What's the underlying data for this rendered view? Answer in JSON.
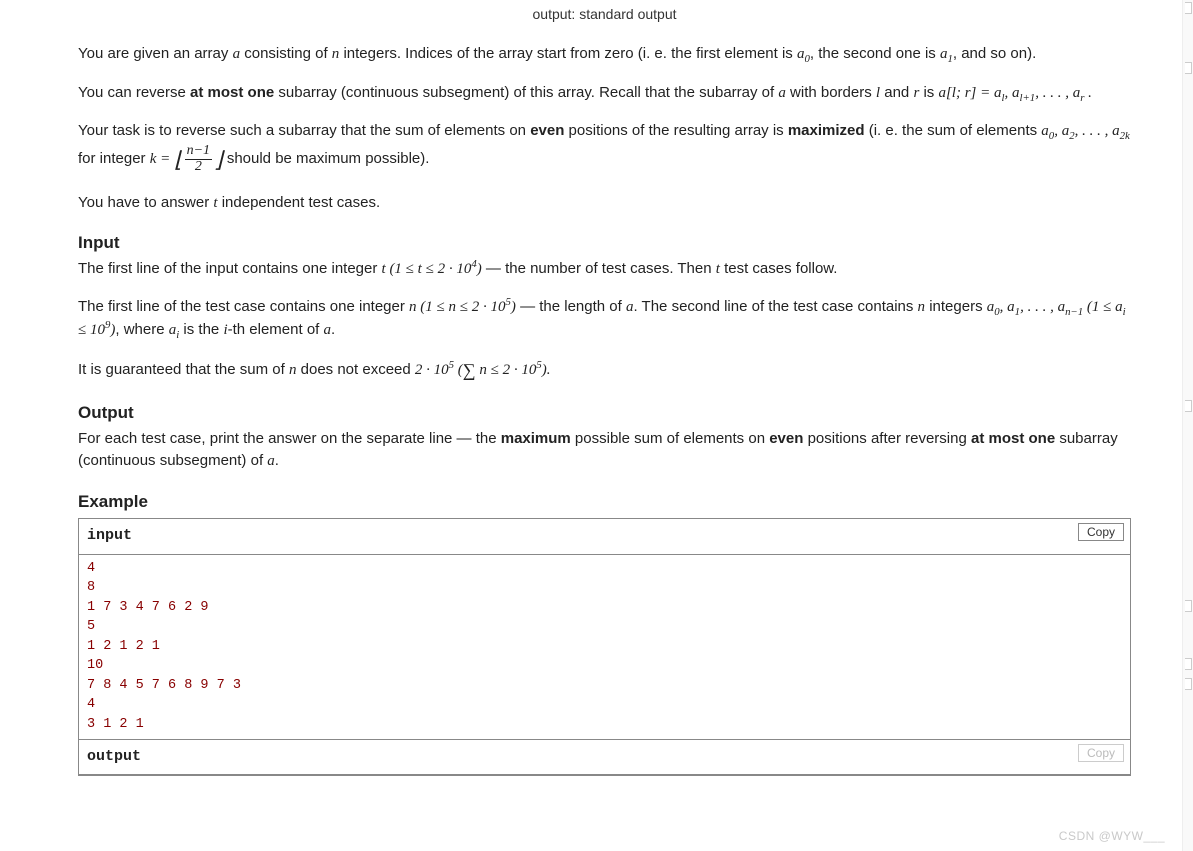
{
  "header": {
    "output_line": "output: standard output"
  },
  "paragraphs": {
    "p1_a": "You are given an array ",
    "p1_b": " consisting of ",
    "p1_c": " integers. Indices of the array start from zero (i. e. the first element is ",
    "p1_d": ", the second one is ",
    "p1_e": ", and so on).",
    "p2_a": "You can reverse ",
    "p2_b": "at most one",
    "p2_c": " subarray (continuous subsegment) of this array. Recall that the subarray of ",
    "p2_d": " with borders ",
    "p2_e": " and ",
    "p2_f": " is ",
    "p3_a": "Your task is to reverse such a subarray that the sum of elements on ",
    "p3_b": "even",
    "p3_c": " positions of the resulting array is ",
    "p3_d": "maximized",
    "p3_e": " (i. e. the sum of elements ",
    "p3_f": " for integer ",
    "p3_g": " should be maximum possible).",
    "p4_a": "You have to answer ",
    "p4_b": " independent test cases."
  },
  "sections": {
    "input_title": "Input",
    "input_p1_a": "The first line of the input contains one integer ",
    "input_p1_b": " — the number of test cases. Then ",
    "input_p1_c": " test cases follow.",
    "input_p2_a": "The first line of the test case contains one integer ",
    "input_p2_b": " — the length of ",
    "input_p2_c": ". The second line of the test case contains ",
    "input_p2_d": " integers ",
    "input_p2_e": ", where ",
    "input_p2_f": " is the ",
    "input_p2_g": "-th element of ",
    "input_p3_a": "It is guaranteed that the sum of ",
    "input_p3_b": " does not exceed ",
    "output_title": "Output",
    "output_p_a": "For each test case, print the answer on the separate line — the ",
    "output_p_b": "maximum",
    "output_p_c": " possible sum of elements on ",
    "output_p_d": "even",
    "output_p_e": " positions after reversing ",
    "output_p_f": "at most one",
    "output_p_g": " subarray (continuous subsegment) of ",
    "example_title": "Example",
    "copy_label": "Copy",
    "input_label": "input",
    "output_label": "output",
    "example_input": "4\n8\n1 7 3 4 7 6 2 9\n5\n1 2 1 2 1\n10\n7 8 4 5 7 6 8 9 7 3\n4\n3 1 2 1"
  },
  "math": {
    "a": "a",
    "n": "n",
    "a0": "a",
    "a0_sub": "0",
    "a1": "a",
    "a1_sub": "1",
    "l": "l",
    "r": "r",
    "alr_expr": "a[l; r] = a",
    "al_sub": "l",
    "alp1": ", a",
    "alp1_sub": "l+1",
    "dots": ", . . . , ",
    "ar": "a",
    "ar_sub": "r",
    "period": " .",
    "seq_even": "a",
    "seq_even_sub0": "0",
    "seq_even_a2": ", a",
    "seq_even_sub2": "2",
    "seq_even_a2k": "a",
    "seq_even_sub2k": "2k",
    "k": "k",
    "k_eq": " = ",
    "frac_num": "n−1",
    "frac_den": "2",
    "t": "t",
    "t_bound": " (1 ≤ t ≤ 2 · 10",
    "t_bound_exp": "4",
    "t_bound_close": ")",
    "n_bound": " (1 ≤ n ≤ 2 · 10",
    "n_bound_exp": "5",
    "n_bound_close": ")",
    "a_seq": "a",
    "a_seq_sub0": "0",
    "a_seq_a1": ", a",
    "a_seq_sub1": "1",
    "a_seq_anm1": "a",
    "a_seq_subnm1": "n−1",
    "ai_bound": " (1 ≤ a",
    "ai_sub": "i",
    "ai_bound2": " ≤ 10",
    "ai_bound_exp": "9",
    "ai_bound_close": ")",
    "ai": "a",
    "i": "i",
    "sum_lim": "2 · 10",
    "sum_exp": "5",
    "sum_paren_open": " (",
    "sum_n_le": " n ≤ 2 · 10",
    "sum_paren_close": ").",
    "period2": "."
  },
  "watermark": "CSDN @WYW___"
}
